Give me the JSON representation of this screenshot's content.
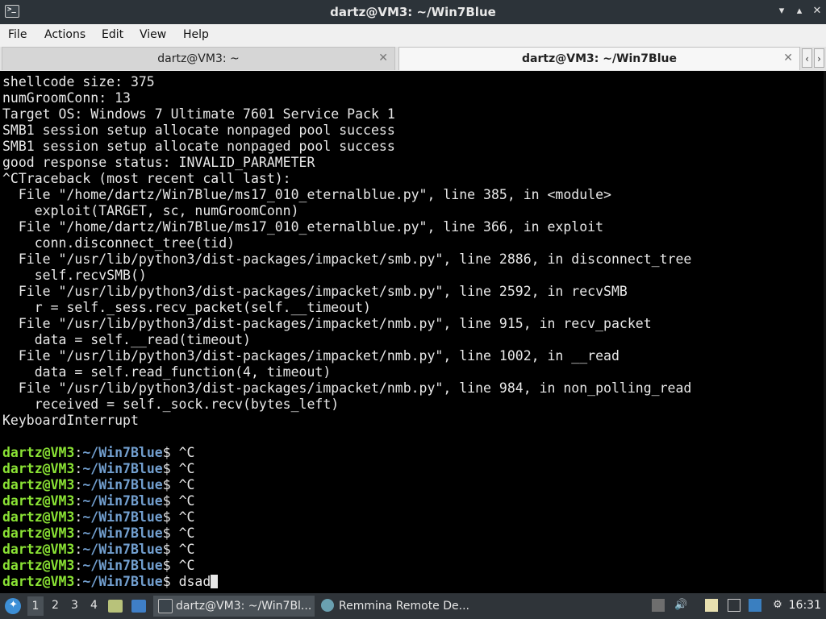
{
  "window": {
    "title": "dartz@VM3: ~/Win7Blue",
    "icon": "terminal-icon",
    "controls": [
      "minimize",
      "maximize",
      "close"
    ]
  },
  "menu": {
    "items": [
      "File",
      "Actions",
      "Edit",
      "View",
      "Help"
    ]
  },
  "tabs": [
    {
      "label": "dartz@VM3: ~",
      "active": false
    },
    {
      "label": "dartz@VM3: ~/Win7Blue",
      "active": true
    }
  ],
  "terminal": {
    "output_lines": [
      "shellcode size: 375",
      "numGroomConn: 13",
      "Target OS: Windows 7 Ultimate 7601 Service Pack 1",
      "SMB1 session setup allocate nonpaged pool success",
      "SMB1 session setup allocate nonpaged pool success",
      "good response status: INVALID_PARAMETER",
      "^CTraceback (most recent call last):",
      "  File \"/home/dartz/Win7Blue/ms17_010_eternalblue.py\", line 385, in <module>",
      "    exploit(TARGET, sc, numGroomConn)",
      "  File \"/home/dartz/Win7Blue/ms17_010_eternalblue.py\", line 366, in exploit",
      "    conn.disconnect_tree(tid)",
      "  File \"/usr/lib/python3/dist-packages/impacket/smb.py\", line 2886, in disconnect_tree",
      "    self.recvSMB()",
      "  File \"/usr/lib/python3/dist-packages/impacket/smb.py\", line 2592, in recvSMB",
      "    r = self._sess.recv_packet(self.__timeout)",
      "  File \"/usr/lib/python3/dist-packages/impacket/nmb.py\", line 915, in recv_packet",
      "    data = self.__read(timeout)",
      "  File \"/usr/lib/python3/dist-packages/impacket/nmb.py\", line 1002, in __read",
      "    data = self.read_function(4, timeout)",
      "  File \"/usr/lib/python3/dist-packages/impacket/nmb.py\", line 984, in non_polling_read",
      "    received = self._sock.recv(bytes_left)",
      "KeyboardInterrupt",
      ""
    ],
    "prompt": {
      "user_host": "dartz@VM3",
      "separator": ":",
      "path": "~/Win7Blue",
      "symbol": "$ "
    },
    "prompt_commands": [
      "^C",
      "^C",
      "^C",
      "^C",
      "^C",
      "^C",
      "^C",
      "^C"
    ],
    "current_input": "dsad",
    "colors": {
      "prompt_user": "#8ae234",
      "prompt_path": "#729fcf",
      "text": "#e8e8e8",
      "background": "#000000"
    }
  },
  "taskbar": {
    "start_icon": "lxqt-menu-icon",
    "workspaces": [
      "1",
      "2",
      "3",
      "4"
    ],
    "current_workspace": "1",
    "quicklaunch": [
      "file-manager-icon",
      "show-desktop-icon"
    ],
    "tasks": [
      {
        "label": "dartz@VM3: ~/Win7Bl...",
        "icon": "terminal-icon",
        "active": true
      },
      {
        "label": "Remmina Remote De...",
        "icon": "remmina-icon",
        "active": false
      }
    ],
    "tray": [
      "clipboard-icon",
      "volume-icon",
      "notes-icon",
      "network-icon",
      "update-icon",
      "settings-icon"
    ],
    "clock": "16:31"
  }
}
